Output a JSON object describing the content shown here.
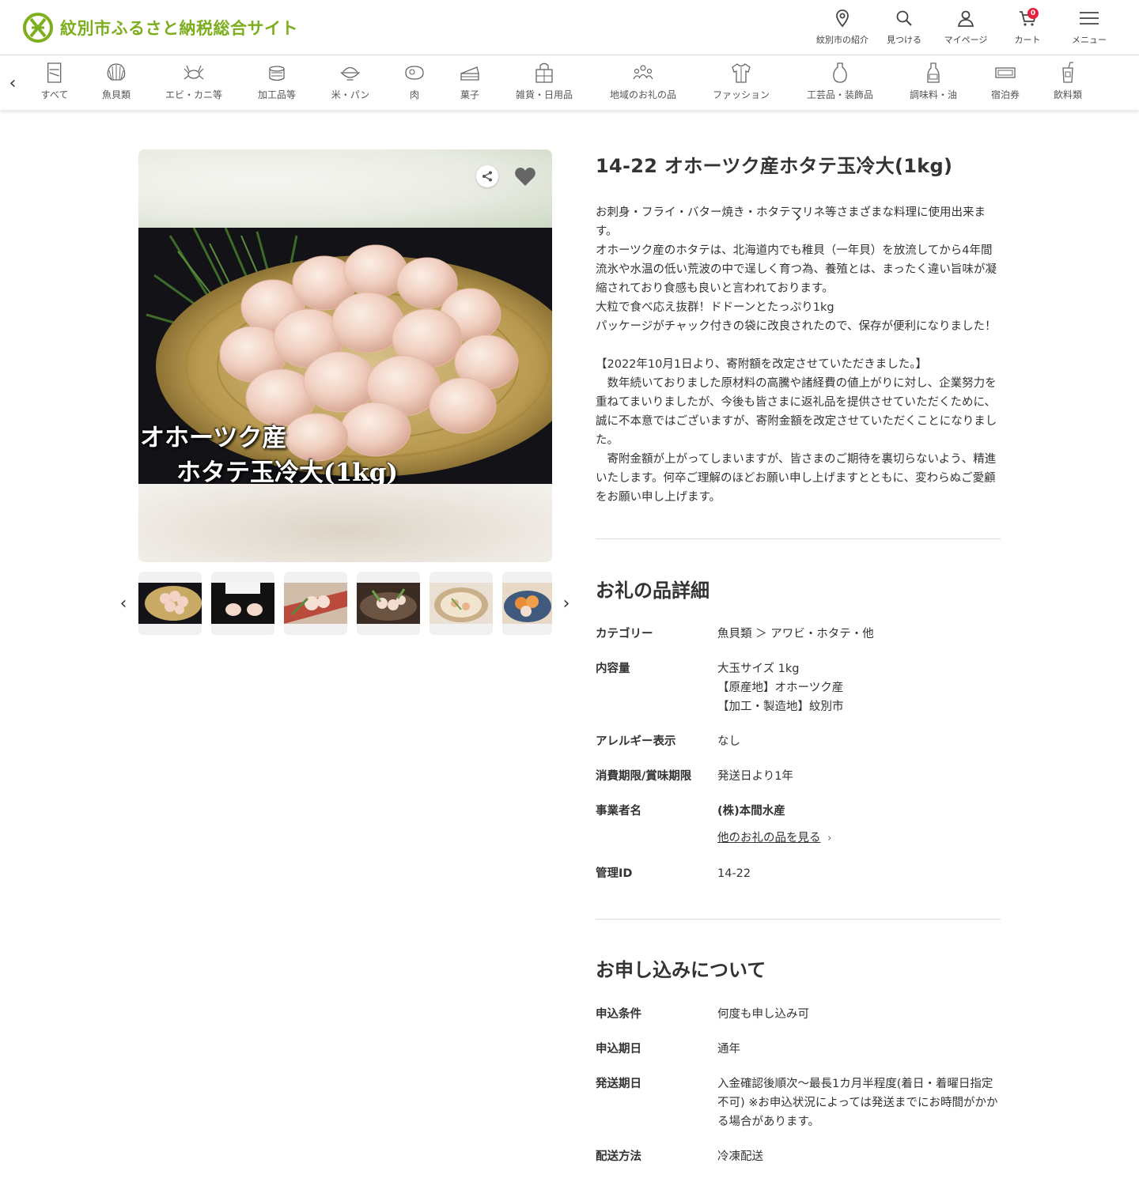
{
  "header": {
    "site_title": "紋別市ふるさと納税総合サイト",
    "nav": [
      {
        "label": "紋別市の紹介",
        "icon": "location-pin-icon"
      },
      {
        "label": "見つける",
        "icon": "search-icon"
      },
      {
        "label": "マイページ",
        "icon": "user-icon"
      },
      {
        "label": "カート",
        "icon": "cart-icon"
      },
      {
        "label": "メニュー",
        "icon": "hamburger-menu-icon"
      }
    ],
    "cart_count": "0",
    "brand_color": "#7cae1e",
    "badge_color": "#e8203b"
  },
  "categories": [
    {
      "label": "すべて",
      "icon": "all-items-icon"
    },
    {
      "label": "魚貝類",
      "icon": "shell-icon"
    },
    {
      "label": "エビ・カニ等",
      "icon": "crab-icon"
    },
    {
      "label": "加工品等",
      "icon": "can-icon"
    },
    {
      "label": "米・パン",
      "icon": "rice-bowl-icon"
    },
    {
      "label": "肉",
      "icon": "meat-icon"
    },
    {
      "label": "菓子",
      "icon": "cake-icon"
    },
    {
      "label": "雑貨・日用品",
      "icon": "bag-icon"
    },
    {
      "label": "地域のお礼の品",
      "icon": "people-icon"
    },
    {
      "label": "ファッション",
      "icon": "shirt-icon"
    },
    {
      "label": "工芸品・装飾品",
      "icon": "vase-icon"
    },
    {
      "label": "調味料・油",
      "icon": "bottle-icon"
    },
    {
      "label": "宿泊券",
      "icon": "ticket-icon"
    },
    {
      "label": "飲料類",
      "icon": "drink-icon"
    }
  ],
  "gallery": {
    "caption_line1": "オホーツク産",
    "caption_line2": "ホタテ玉冷大(1kg)",
    "thumbnail_count": 6
  },
  "product": {
    "title": "14-22 オホーツク産ホタテ玉冷大(1kg)",
    "description": "お刺身・フライ・バター焼き・ホタテマリネ等さまざまな料理に使用出来ます。\nオホーツク産のホタテは、北海道内でも稚貝（一年貝）を放流してから4年間流氷や水温の低い荒波の中で逞しく育つ為、養殖とは、まったく違い旨味が凝縮されており食感も良いと言われております。\n大粒で食べ応え抜群！ドドーンとたっぷり1kg\nパッケージがチャック付きの袋に改良されたので、保存が便利になりました！\n\n【2022年10月1日より、寄附額を改定させていただきました。】\n　数年続いておりました原材料の高騰や諸経費の値上がりに対し、企業努力を重ねてまいりましたが、今後も皆さまに返礼品を提供させていただくために、誠に不本意ではございますが、寄附金額を改定させていただくことになりました。\n　寄附金額が上がってしまいますが、皆さまのご期待を裏切らないよう、精進いたします。何卒ご理解のほどお願い申し上げますとともに、変わらぬご愛顧をお願い申し上げます。"
  },
  "details": {
    "heading": "お礼の品詳細",
    "category_label": "カテゴリー",
    "category_value": "魚貝類 ＞ アワビ・ホタテ・他",
    "content_label": "内容量",
    "content_value": "大玉サイズ 1kg\n【原産地】オホーツク産\n【加工・製造地】紋別市",
    "allergy_label": "アレルギー表示",
    "allergy_value": "なし",
    "expiry_label": "消費期限/賞味期限",
    "expiry_value": "発送日より1年",
    "business_label": "事業者名",
    "business_value": "(株)本間水産",
    "other_items_link": "他のお礼の品を見る",
    "id_label": "管理ID",
    "id_value": "14-22"
  },
  "application": {
    "heading": "お申し込みについて",
    "condition_label": "申込条件",
    "condition_value": "何度も申し込み可",
    "period_label": "申込期日",
    "period_value": "通年",
    "shipping_label": "発送期日",
    "shipping_value": "入金確認後順次～最長1カ月半程度(着日・着曜日指定不可) ※お申込状況によっては発送までにお時間がかかる場合があります。",
    "delivery_label": "配送方法",
    "delivery_value": "冷凍配送"
  }
}
